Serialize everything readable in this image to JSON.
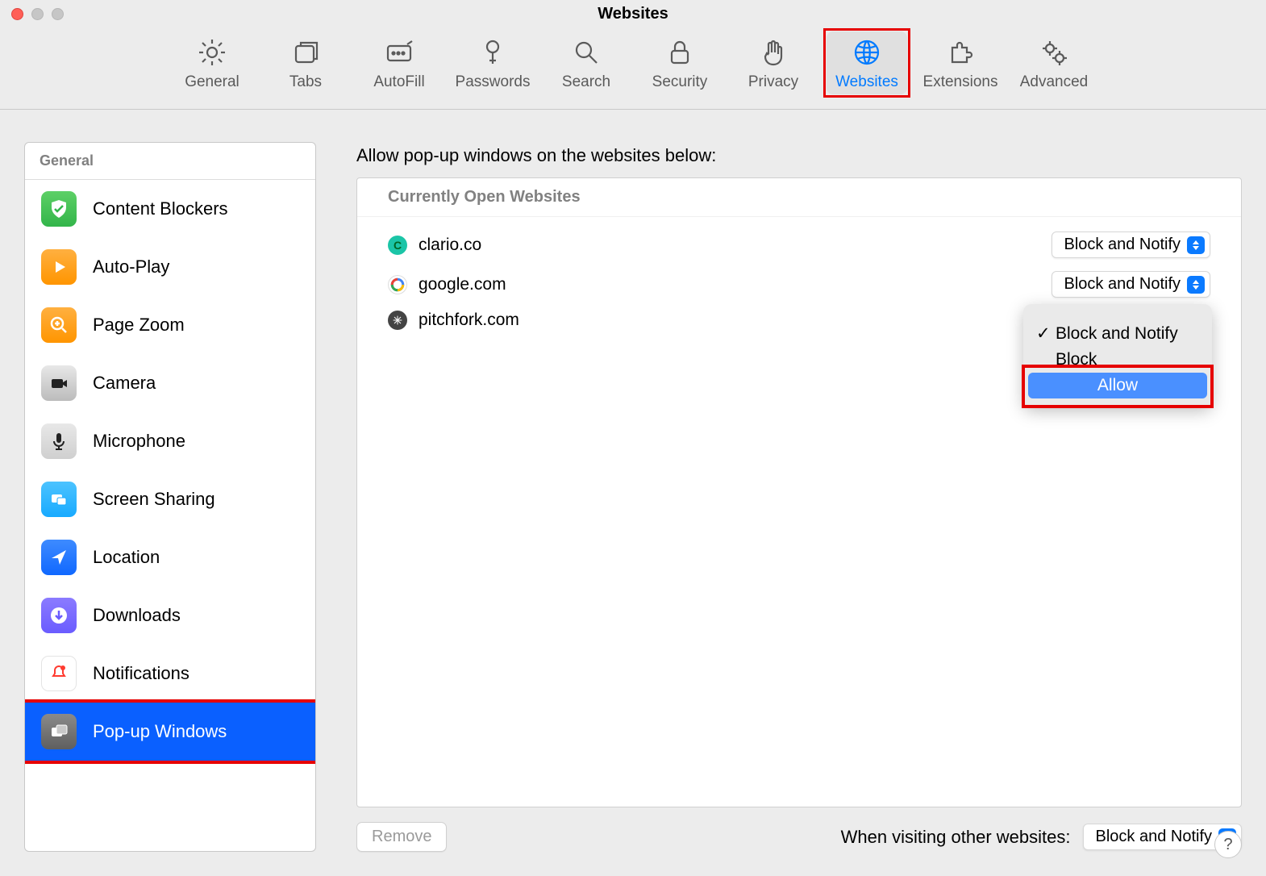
{
  "window_title": "Websites",
  "toolbar": {
    "items": [
      {
        "key": "general",
        "label": "General"
      },
      {
        "key": "tabs",
        "label": "Tabs"
      },
      {
        "key": "autofill",
        "label": "AutoFill"
      },
      {
        "key": "passwords",
        "label": "Passwords"
      },
      {
        "key": "search",
        "label": "Search"
      },
      {
        "key": "security",
        "label": "Security"
      },
      {
        "key": "privacy",
        "label": "Privacy"
      },
      {
        "key": "websites",
        "label": "Websites"
      },
      {
        "key": "extensions",
        "label": "Extensions"
      },
      {
        "key": "advanced",
        "label": "Advanced"
      }
    ],
    "active": "websites"
  },
  "sidebar": {
    "header": "General",
    "items": [
      {
        "label": "Content Blockers"
      },
      {
        "label": "Auto-Play"
      },
      {
        "label": "Page Zoom"
      },
      {
        "label": "Camera"
      },
      {
        "label": "Microphone"
      },
      {
        "label": "Screen Sharing"
      },
      {
        "label": "Location"
      },
      {
        "label": "Downloads"
      },
      {
        "label": "Notifications"
      },
      {
        "label": "Pop-up Windows"
      }
    ],
    "selected_index": 9
  },
  "main": {
    "heading": "Allow pop-up windows on the websites below:",
    "table_header": "Currently Open Websites",
    "rows": [
      {
        "domain": "clario.co",
        "value": "Block and Notify"
      },
      {
        "domain": "google.com",
        "value": "Block and Notify"
      },
      {
        "domain": "pitchfork.com",
        "value": "Block and Notify"
      }
    ],
    "dropdown": {
      "options": [
        "Block and Notify",
        "Block",
        "Allow"
      ],
      "checked_index": 0,
      "hover_index": 2
    },
    "remove_label": "Remove",
    "footer_label": "When visiting other websites:",
    "footer_value": "Block and Notify"
  },
  "help_label": "?"
}
